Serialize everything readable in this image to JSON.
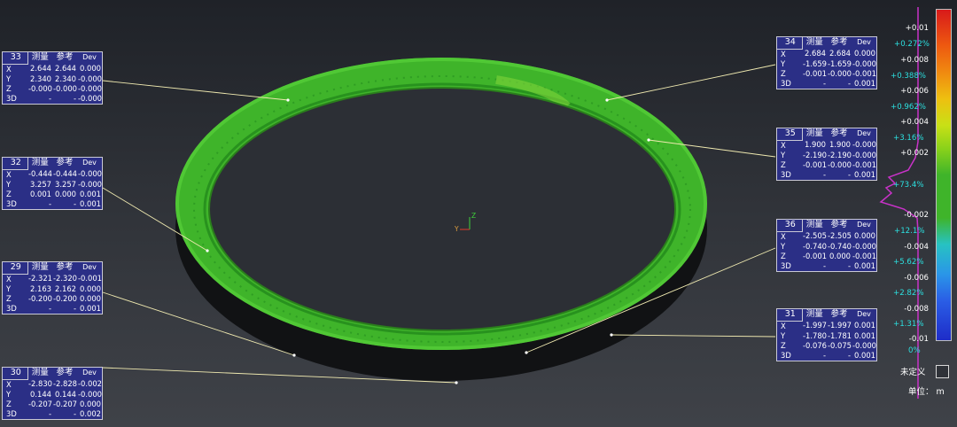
{
  "annotations": [
    {
      "id": "33",
      "rows": [
        [
          "X",
          "2.644",
          "2.644",
          "0.000"
        ],
        [
          "Y",
          "2.340",
          "2.340",
          "-0.000"
        ],
        [
          "Z",
          "-0.000",
          "-0.000",
          "-0.000"
        ],
        [
          "3D",
          "-",
          "-",
          "-0.000"
        ]
      ]
    },
    {
      "id": "32",
      "rows": [
        [
          "X",
          "-0.444",
          "-0.444",
          "-0.000"
        ],
        [
          "Y",
          "3.257",
          "3.257",
          "-0.000"
        ],
        [
          "Z",
          "0.001",
          "0.000",
          "0.001"
        ],
        [
          "3D",
          "-",
          "-",
          "0.001"
        ]
      ]
    },
    {
      "id": "29",
      "rows": [
        [
          "X",
          "-2.321",
          "-2.320",
          "-0.001"
        ],
        [
          "Y",
          "2.163",
          "2.162",
          "0.000"
        ],
        [
          "Z",
          "-0.200",
          "-0.200",
          "0.000"
        ],
        [
          "3D",
          "-",
          "-",
          "0.001"
        ]
      ]
    },
    {
      "id": "30",
      "rows": [
        [
          "X",
          "-2.830",
          "-2.828",
          "-0.002"
        ],
        [
          "Y",
          "0.144",
          "0.144",
          "-0.000"
        ],
        [
          "Z",
          "-0.207",
          "-0.207",
          "0.000"
        ],
        [
          "3D",
          "-",
          "-",
          "0.002"
        ]
      ]
    },
    {
      "id": "34",
      "rows": [
        [
          "X",
          "2.684",
          "2.684",
          "0.000"
        ],
        [
          "Y",
          "-1.659",
          "-1.659",
          "-0.000"
        ],
        [
          "Z",
          "-0.001",
          "-0.000",
          "-0.001"
        ],
        [
          "3D",
          "-",
          "-",
          "0.001"
        ]
      ]
    },
    {
      "id": "35",
      "rows": [
        [
          "X",
          "1.900",
          "1.900",
          "-0.000"
        ],
        [
          "Y",
          "-2.190",
          "-2.190",
          "-0.000"
        ],
        [
          "Z",
          "-0.001",
          "-0.000",
          "-0.001"
        ],
        [
          "3D",
          "-",
          "-",
          "0.001"
        ]
      ]
    },
    {
      "id": "36",
      "rows": [
        [
          "X",
          "-2.505",
          "-2.505",
          "0.000"
        ],
        [
          "Y",
          "-0.740",
          "-0.740",
          "-0.000"
        ],
        [
          "Z",
          "-0.001",
          "0.000",
          "-0.001"
        ],
        [
          "3D",
          "-",
          "-",
          "0.001"
        ]
      ]
    },
    {
      "id": "31",
      "rows": [
        [
          "X",
          "-1.997",
          "-1.997",
          "0.001"
        ],
        [
          "Y",
          "-1.780",
          "-1.781",
          "0.001"
        ],
        [
          "Z",
          "-0.076",
          "-0.075",
          "-0.000"
        ],
        [
          "3D",
          "-",
          "-",
          "0.001"
        ]
      ]
    }
  ],
  "headers": {
    "measured": "测量",
    "reference": "参考",
    "dev": "Dev"
  },
  "legend": {
    "ticks": [
      "+0.01",
      "+0.008",
      "+0.006",
      "+0.004",
      "+0.002",
      "-0.002",
      "-0.004",
      "-0.006",
      "-0.008",
      "-0.01"
    ],
    "percents": [
      "+0.272%",
      "+0.388%",
      "+0.962%",
      "+3.16%",
      "+73.4%",
      "+12.1%",
      "+5.62%",
      "+2.82%",
      "+1.31%",
      "0%"
    ],
    "undefined_label": "未定义",
    "unit_label": "单位： m"
  },
  "axes": {
    "x": "Y",
    "z": "Z"
  },
  "colors": {
    "panel": "#2b2f86",
    "ring": "#3fb42a",
    "percent_text": "#2ce0e0",
    "histogram": "#c832c8",
    "leader": "#efe9b0"
  }
}
